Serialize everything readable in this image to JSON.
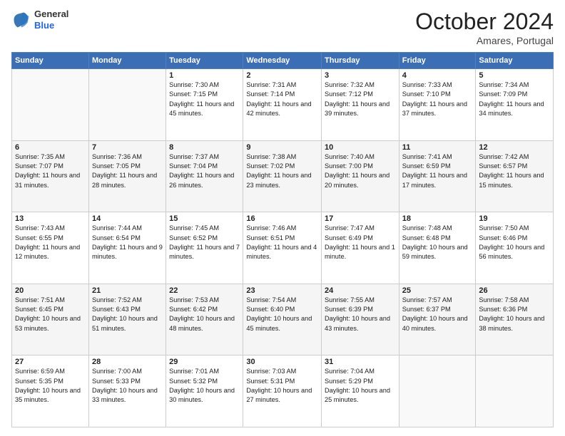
{
  "header": {
    "logo": {
      "line1": "General",
      "line2": "Blue"
    },
    "title": "October 2024",
    "location": "Amares, Portugal"
  },
  "weekdays": [
    "Sunday",
    "Monday",
    "Tuesday",
    "Wednesday",
    "Thursday",
    "Friday",
    "Saturday"
  ],
  "weeks": [
    [
      {
        "day": "",
        "info": ""
      },
      {
        "day": "",
        "info": ""
      },
      {
        "day": "1",
        "info": "Sunrise: 7:30 AM\nSunset: 7:15 PM\nDaylight: 11 hours and 45 minutes."
      },
      {
        "day": "2",
        "info": "Sunrise: 7:31 AM\nSunset: 7:14 PM\nDaylight: 11 hours and 42 minutes."
      },
      {
        "day": "3",
        "info": "Sunrise: 7:32 AM\nSunset: 7:12 PM\nDaylight: 11 hours and 39 minutes."
      },
      {
        "day": "4",
        "info": "Sunrise: 7:33 AM\nSunset: 7:10 PM\nDaylight: 11 hours and 37 minutes."
      },
      {
        "day": "5",
        "info": "Sunrise: 7:34 AM\nSunset: 7:09 PM\nDaylight: 11 hours and 34 minutes."
      }
    ],
    [
      {
        "day": "6",
        "info": "Sunrise: 7:35 AM\nSunset: 7:07 PM\nDaylight: 11 hours and 31 minutes."
      },
      {
        "day": "7",
        "info": "Sunrise: 7:36 AM\nSunset: 7:05 PM\nDaylight: 11 hours and 28 minutes."
      },
      {
        "day": "8",
        "info": "Sunrise: 7:37 AM\nSunset: 7:04 PM\nDaylight: 11 hours and 26 minutes."
      },
      {
        "day": "9",
        "info": "Sunrise: 7:38 AM\nSunset: 7:02 PM\nDaylight: 11 hours and 23 minutes."
      },
      {
        "day": "10",
        "info": "Sunrise: 7:40 AM\nSunset: 7:00 PM\nDaylight: 11 hours and 20 minutes."
      },
      {
        "day": "11",
        "info": "Sunrise: 7:41 AM\nSunset: 6:59 PM\nDaylight: 11 hours and 17 minutes."
      },
      {
        "day": "12",
        "info": "Sunrise: 7:42 AM\nSunset: 6:57 PM\nDaylight: 11 hours and 15 minutes."
      }
    ],
    [
      {
        "day": "13",
        "info": "Sunrise: 7:43 AM\nSunset: 6:55 PM\nDaylight: 11 hours and 12 minutes."
      },
      {
        "day": "14",
        "info": "Sunrise: 7:44 AM\nSunset: 6:54 PM\nDaylight: 11 hours and 9 minutes."
      },
      {
        "day": "15",
        "info": "Sunrise: 7:45 AM\nSunset: 6:52 PM\nDaylight: 11 hours and 7 minutes."
      },
      {
        "day": "16",
        "info": "Sunrise: 7:46 AM\nSunset: 6:51 PM\nDaylight: 11 hours and 4 minutes."
      },
      {
        "day": "17",
        "info": "Sunrise: 7:47 AM\nSunset: 6:49 PM\nDaylight: 11 hours and 1 minute."
      },
      {
        "day": "18",
        "info": "Sunrise: 7:48 AM\nSunset: 6:48 PM\nDaylight: 10 hours and 59 minutes."
      },
      {
        "day": "19",
        "info": "Sunrise: 7:50 AM\nSunset: 6:46 PM\nDaylight: 10 hours and 56 minutes."
      }
    ],
    [
      {
        "day": "20",
        "info": "Sunrise: 7:51 AM\nSunset: 6:45 PM\nDaylight: 10 hours and 53 minutes."
      },
      {
        "day": "21",
        "info": "Sunrise: 7:52 AM\nSunset: 6:43 PM\nDaylight: 10 hours and 51 minutes."
      },
      {
        "day": "22",
        "info": "Sunrise: 7:53 AM\nSunset: 6:42 PM\nDaylight: 10 hours and 48 minutes."
      },
      {
        "day": "23",
        "info": "Sunrise: 7:54 AM\nSunset: 6:40 PM\nDaylight: 10 hours and 45 minutes."
      },
      {
        "day": "24",
        "info": "Sunrise: 7:55 AM\nSunset: 6:39 PM\nDaylight: 10 hours and 43 minutes."
      },
      {
        "day": "25",
        "info": "Sunrise: 7:57 AM\nSunset: 6:37 PM\nDaylight: 10 hours and 40 minutes."
      },
      {
        "day": "26",
        "info": "Sunrise: 7:58 AM\nSunset: 6:36 PM\nDaylight: 10 hours and 38 minutes."
      }
    ],
    [
      {
        "day": "27",
        "info": "Sunrise: 6:59 AM\nSunset: 5:35 PM\nDaylight: 10 hours and 35 minutes."
      },
      {
        "day": "28",
        "info": "Sunrise: 7:00 AM\nSunset: 5:33 PM\nDaylight: 10 hours and 33 minutes."
      },
      {
        "day": "29",
        "info": "Sunrise: 7:01 AM\nSunset: 5:32 PM\nDaylight: 10 hours and 30 minutes."
      },
      {
        "day": "30",
        "info": "Sunrise: 7:03 AM\nSunset: 5:31 PM\nDaylight: 10 hours and 27 minutes."
      },
      {
        "day": "31",
        "info": "Sunrise: 7:04 AM\nSunset: 5:29 PM\nDaylight: 10 hours and 25 minutes."
      },
      {
        "day": "",
        "info": ""
      },
      {
        "day": "",
        "info": ""
      }
    ]
  ]
}
